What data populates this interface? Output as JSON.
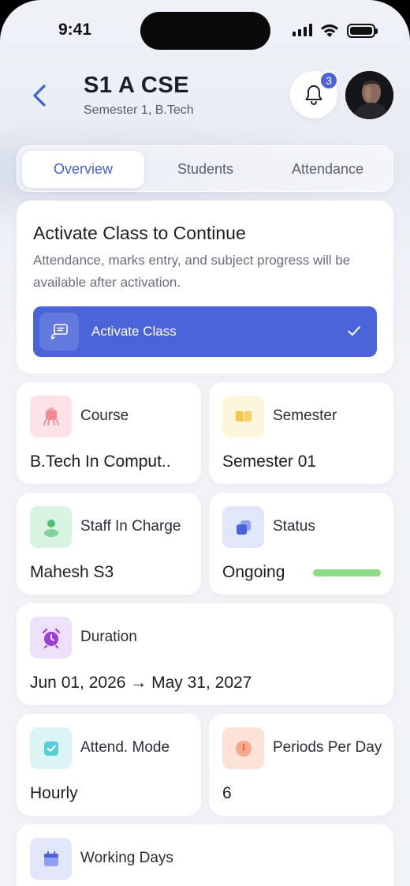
{
  "status_bar": {
    "time": "9:41"
  },
  "header": {
    "title": "S1 A CSE",
    "subtitle": "Semester 1, B.Tech",
    "notification_count": "3"
  },
  "tabs": [
    {
      "label": "Overview",
      "active": true
    },
    {
      "label": "Students",
      "active": false
    },
    {
      "label": "Attendance",
      "active": false
    }
  ],
  "activate_card": {
    "title": "Activate Class to Continue",
    "description": "Attendance, marks entry, and subject progress will be available after activation.",
    "button_label": "Activate Class"
  },
  "info": {
    "course": {
      "label": "Course",
      "value": "B.Tech In Comput.."
    },
    "semester": {
      "label": "Semester",
      "value": "Semester 01"
    },
    "staff": {
      "label": "Staff In Charge",
      "value": "Mahesh S3"
    },
    "status": {
      "label": "Status",
      "value": "Ongoing",
      "progress": 1.0
    },
    "duration": {
      "label": "Duration",
      "value": "Jun 01, 2026 → May 31, 2027"
    },
    "attend_mode": {
      "label": "Attend. Mode",
      "value": "Hourly"
    },
    "periods": {
      "label": "Periods Per Day",
      "value": "6"
    },
    "working_days": {
      "label": "Working Days"
    }
  },
  "colors": {
    "accent": "#4b63d9",
    "status_progress": "#8edc86"
  }
}
